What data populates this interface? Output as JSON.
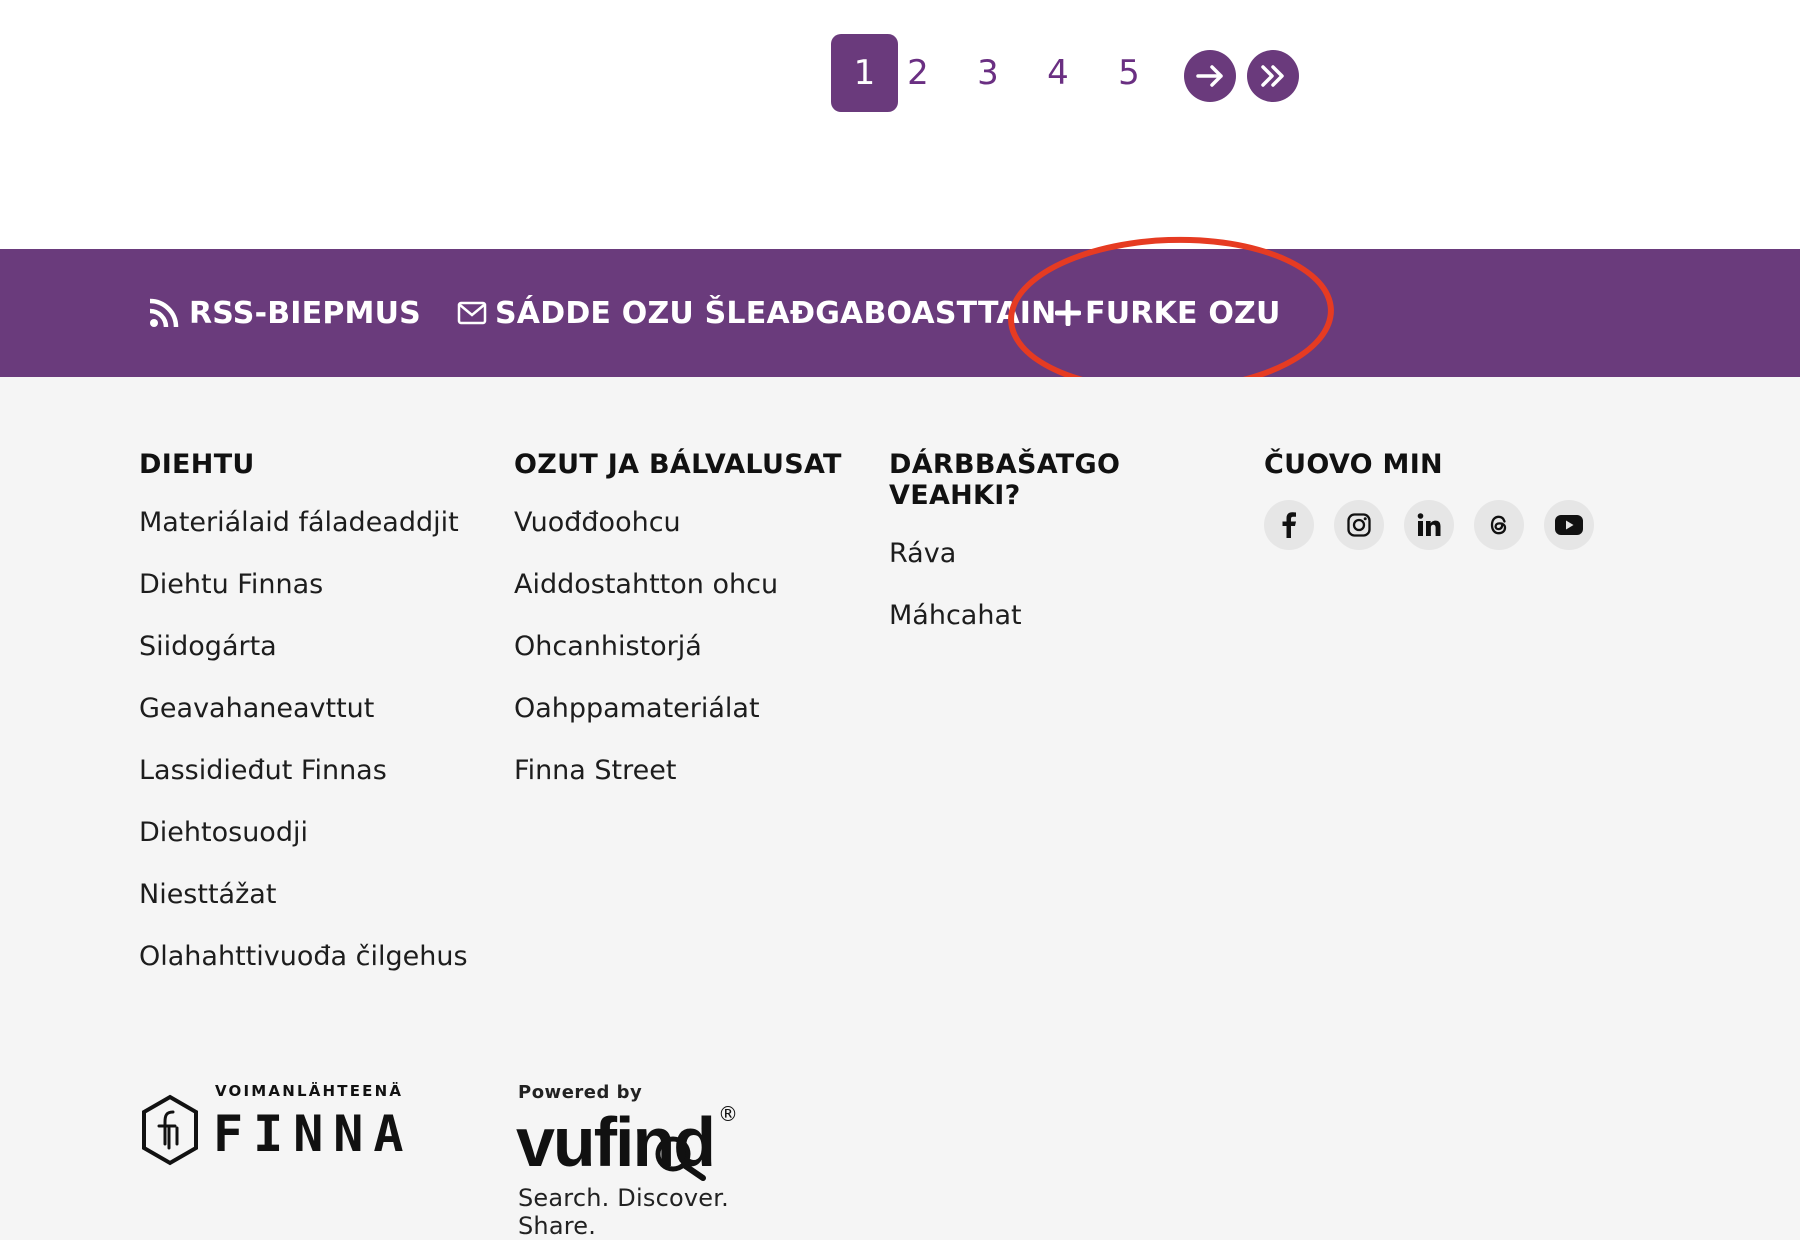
{
  "pagination": {
    "pages": [
      "1",
      "2",
      "3",
      "4",
      "5"
    ],
    "current": "1",
    "next_icon": "arrow-right-icon",
    "last_icon": "double-chevron-right-icon"
  },
  "action_bar": {
    "rss_label": "RSS-BIEPMUS",
    "rss_icon": "rss-icon",
    "email_label": "SÁDDE OZU ŠLEAĐGABOASTTAIN",
    "email_icon": "envelope-icon",
    "save_label": "FURKE OZU",
    "save_icon": "plus-icon",
    "accent": "#6a3b7c",
    "highlight_color": "#e63b22"
  },
  "footer": {
    "col1": {
      "title": "DIEHTU",
      "items": [
        "Materiálaid fáladeaddjit",
        "Diehtu Finnas",
        "Siidogárta",
        "Geavahaneavttut",
        "Lassidieđut Finnas",
        "Diehtosuodji",
        "Niesttážat",
        "Olahahttivuođa čilgehus"
      ]
    },
    "col2": {
      "title": "OZUT JA BÁLVALUSAT",
      "items": [
        "Vuođđoohcu",
        "Aiddostahtton ohcu",
        "Ohcanhistorjá",
        "Oahppamateriálat",
        "Finna Street"
      ]
    },
    "col3": {
      "title": "DÁRBBAŠATGO VEAHKI?",
      "items": [
        "Ráva",
        "Máhcahat"
      ]
    },
    "col4": {
      "title": "ČUOVO MIN",
      "social": [
        "facebook-icon",
        "instagram-icon",
        "linkedin-icon",
        "threads-icon",
        "youtube-icon"
      ]
    },
    "logo_finna": {
      "tagline": "VOIMANLÄHTEENÄ",
      "wordmark": "FINNA"
    },
    "logo_vufind": {
      "powered": "Powered by",
      "wordmark": "vufind",
      "registered": "®",
      "slogan": "Search. Discover. Share."
    }
  }
}
